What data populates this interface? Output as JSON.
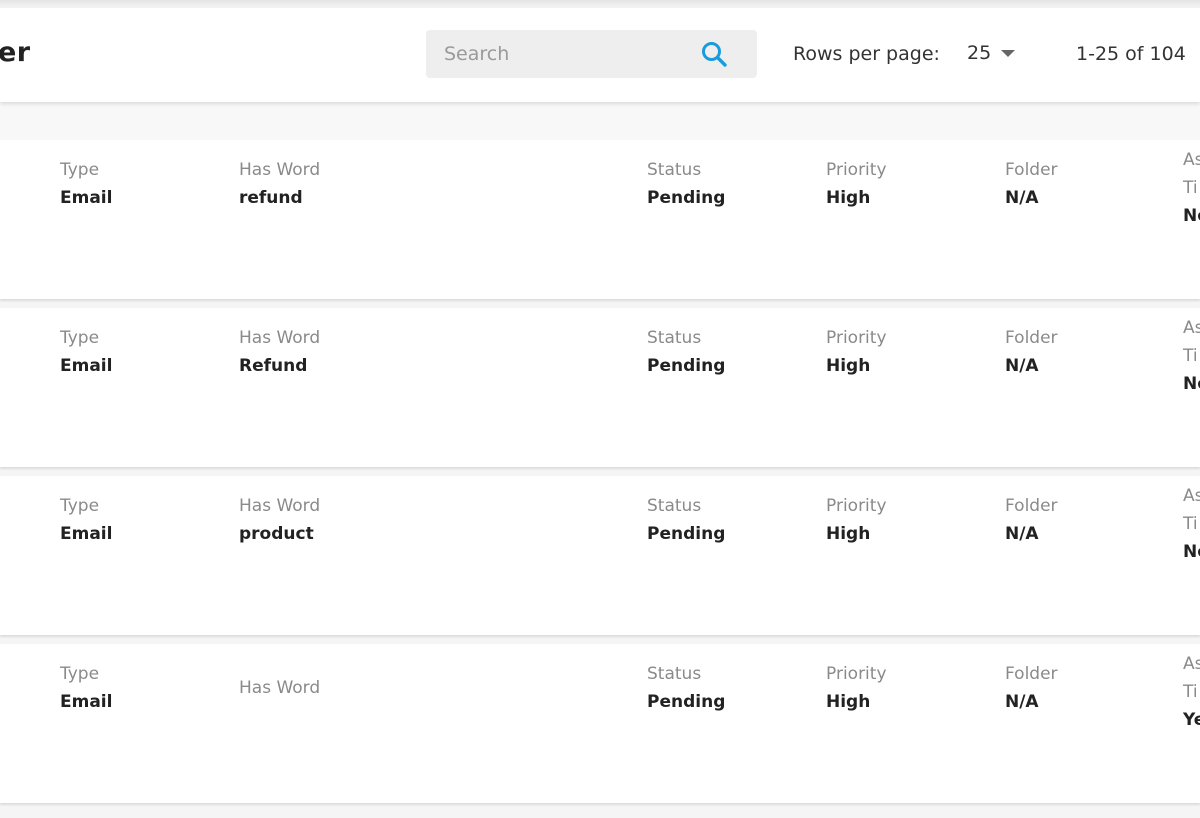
{
  "header": {
    "title_fragment": "er",
    "search": {
      "placeholder": "Search",
      "value": ""
    },
    "rows_per_page_label": "Rows per page:",
    "rows_per_page_value": "25",
    "pagination_range": "1-25 of 104"
  },
  "rules": [
    {
      "type_label": "Type",
      "type_value": "Email",
      "word_label": "Has Word",
      "word_value": "refund",
      "status_label": "Status",
      "status_value": "Pending",
      "priority_label": "Priority",
      "priority_value": "High",
      "folder_label": "Folder",
      "folder_value": "N/A",
      "assign_line1": "As",
      "assign_line2": "Ti",
      "assign_value": "No"
    },
    {
      "type_label": "Type",
      "type_value": "Email",
      "word_label": "Has Word",
      "word_value": "Refund",
      "status_label": "Status",
      "status_value": "Pending",
      "priority_label": "Priority",
      "priority_value": "High",
      "folder_label": "Folder",
      "folder_value": "N/A",
      "assign_line1": "As",
      "assign_line2": "Ti",
      "assign_value": "No"
    },
    {
      "type_label": "Type",
      "type_value": "Email",
      "word_label": "Has Word",
      "word_value": "product",
      "status_label": "Status",
      "status_value": "Pending",
      "priority_label": "Priority",
      "priority_value": "High",
      "folder_label": "Folder",
      "folder_value": "N/A",
      "assign_line1": "As",
      "assign_line2": "Ti",
      "assign_value": "No"
    },
    {
      "type_label": "Type",
      "type_value": "Email",
      "word_label": "Has Word",
      "word_value": "",
      "status_label": "Status",
      "status_value": "Pending",
      "priority_label": "Priority",
      "priority_value": "High",
      "folder_label": "Folder",
      "folder_value": "N/A",
      "assign_line1": "As",
      "assign_line2": "Ti",
      "assign_value": "Ye"
    }
  ],
  "colors": {
    "accent": "#1a9bdc",
    "page_background": "#f5f5f5",
    "card_background": "#ffffff",
    "label_text": "#8a8a8a",
    "value_text": "#222222"
  },
  "icons": {
    "search": "search-icon",
    "rows_dropdown": "chevron-down-icon"
  }
}
